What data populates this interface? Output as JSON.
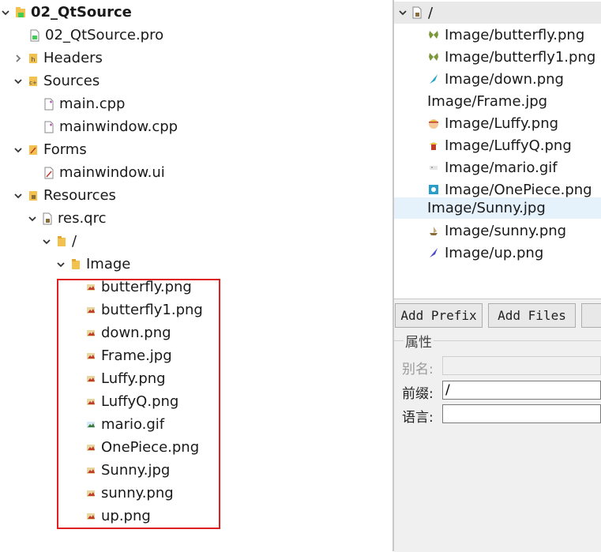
{
  "project_tree": {
    "project": {
      "label": "02_QtSource"
    },
    "pro_file": {
      "label": "02_QtSource.pro"
    },
    "headers": {
      "label": "Headers"
    },
    "sources": {
      "label": "Sources"
    },
    "main_cpp": {
      "label": "main.cpp"
    },
    "mainwindow_cpp": {
      "label": "mainwindow.cpp"
    },
    "forms": {
      "label": "Forms"
    },
    "mainwindow_ui": {
      "label": "mainwindow.ui"
    },
    "resources": {
      "label": "Resources"
    },
    "res_qrc": {
      "label": "res.qrc"
    },
    "prefix": {
      "label": "/"
    },
    "image_folder": {
      "label": "Image"
    },
    "images": [
      {
        "label": "butterfly.png"
      },
      {
        "label": "butterfly1.png"
      },
      {
        "label": "down.png"
      },
      {
        "label": "Frame.jpg"
      },
      {
        "label": "Luffy.png"
      },
      {
        "label": "LuffyQ.png"
      },
      {
        "label": "mario.gif"
      },
      {
        "label": "OnePiece.png"
      },
      {
        "label": "Sunny.jpg"
      },
      {
        "label": "sunny.png"
      },
      {
        "label": "up.png"
      }
    ]
  },
  "resource_editor": {
    "root": {
      "label": "/"
    },
    "items": [
      {
        "label": "Image/butterfly.png",
        "icon": "butterfly-icon"
      },
      {
        "label": "Image/butterfly1.png",
        "icon": "butterfly-icon"
      },
      {
        "label": "Image/down.png",
        "icon": "feather-icon"
      },
      {
        "label": "Image/Frame.jpg",
        "icon": ""
      },
      {
        "label": "Image/Luffy.png",
        "icon": "luffy-icon"
      },
      {
        "label": "Image/LuffyQ.png",
        "icon": "luffyq-icon"
      },
      {
        "label": "Image/mario.gif",
        "icon": "mario-icon"
      },
      {
        "label": "Image/OnePiece.png",
        "icon": "onepiece-icon"
      },
      {
        "label": "Image/Sunny.jpg",
        "icon": "",
        "selected": true
      },
      {
        "label": "Image/sunny.png",
        "icon": "ship-icon"
      },
      {
        "label": "Image/up.png",
        "icon": "feather-icon"
      }
    ],
    "buttons": {
      "add_prefix": "Add Prefix",
      "add_files": "Add Files"
    },
    "properties": {
      "title": "属性",
      "alias_label": "别名:",
      "alias_value": "",
      "prefix_label": "前缀:",
      "prefix_value": "/",
      "language_label": "语言:",
      "language_value": ""
    }
  },
  "colors": {
    "highlight_box": "#e02020",
    "selection": "#e5f1fb",
    "folder": "#f2c14e"
  }
}
